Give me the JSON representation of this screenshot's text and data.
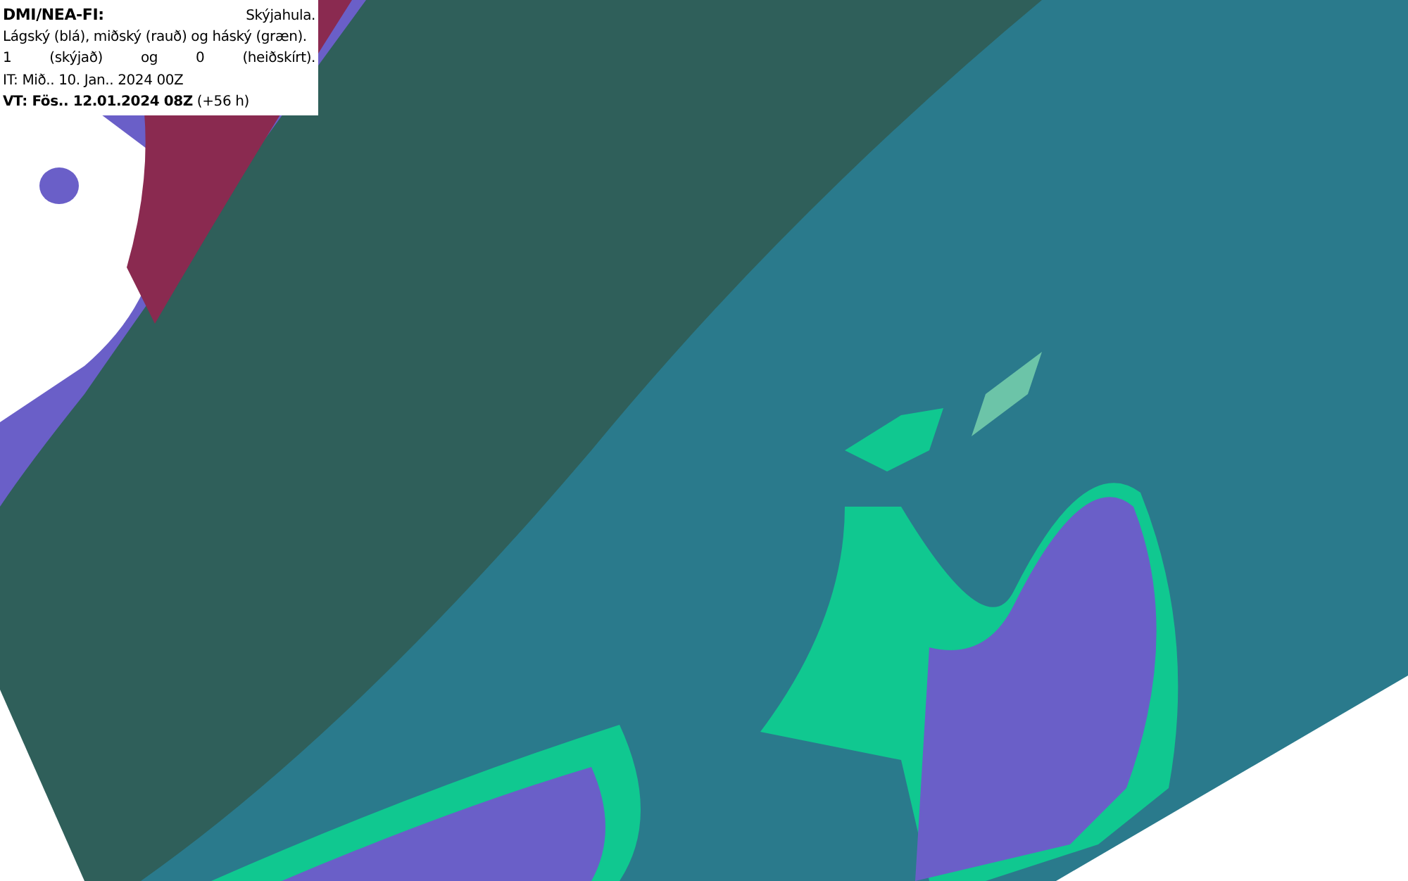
{
  "legend": {
    "title": "DMI/NEA-FI:",
    "subtitle": "Skýjahula.",
    "lines": [
      "Lágský (blá), miðský (rauð) og háský (græn).",
      "1 (skýjað) og 0 (heiðskírt).",
      "IT: Mið.. 10. Jan.. 2024 00Z",
      "**VT: Fös.. 12.01.2024 08Z** (+56 h)"
    ]
  }
}
